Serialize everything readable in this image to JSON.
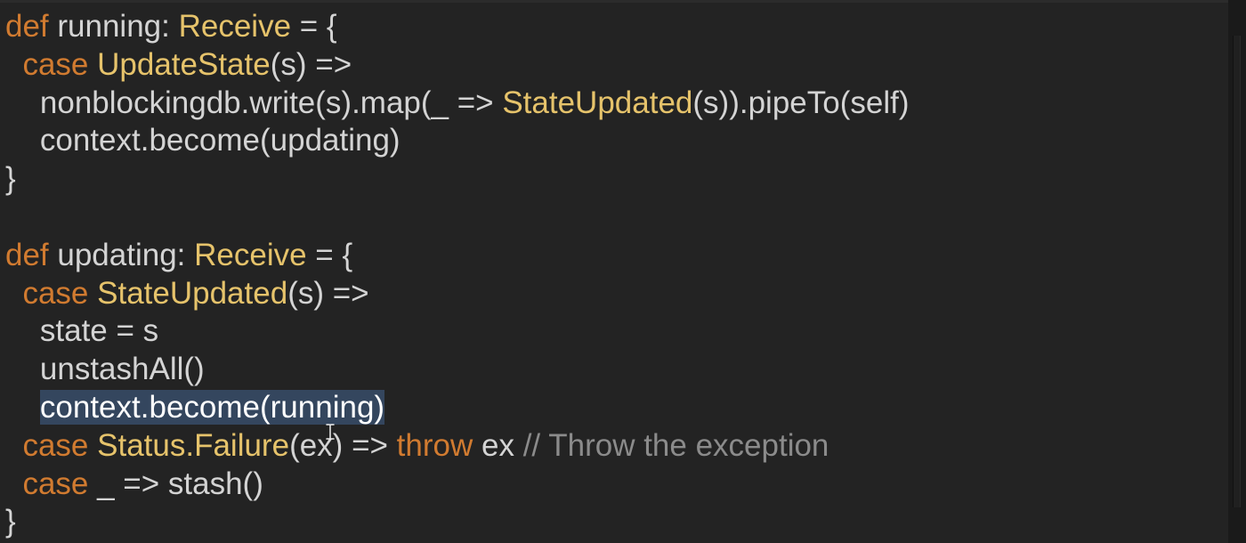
{
  "code_editor": {
    "lines": [
      [
        {
          "text": "def",
          "role": "kw"
        },
        {
          "text": " running: ",
          "role": "plain"
        },
        {
          "text": "Receive",
          "role": "type"
        },
        {
          "text": " = {",
          "role": "plain"
        }
      ],
      [
        {
          "text": "  ",
          "role": "plain"
        },
        {
          "text": "case",
          "role": "kw"
        },
        {
          "text": " ",
          "role": "plain"
        },
        {
          "text": "UpdateState",
          "role": "type"
        },
        {
          "text": "(s) =>",
          "role": "plain"
        }
      ],
      [
        {
          "text": "    nonblockingdb.write(s).map(_ => ",
          "role": "plain"
        },
        {
          "text": "StateUpdated",
          "role": "type"
        },
        {
          "text": "(s)).pipeTo(self)",
          "role": "plain"
        }
      ],
      [
        {
          "text": "    context.become(updating)",
          "role": "plain"
        }
      ],
      [
        {
          "text": "}",
          "role": "plain"
        }
      ],
      [
        {
          "text": "",
          "role": "plain"
        }
      ],
      [
        {
          "text": "def",
          "role": "kw"
        },
        {
          "text": " updating: ",
          "role": "plain"
        },
        {
          "text": "Receive",
          "role": "type"
        },
        {
          "text": " = {",
          "role": "plain"
        }
      ],
      [
        {
          "text": "  ",
          "role": "plain"
        },
        {
          "text": "case",
          "role": "kw"
        },
        {
          "text": " ",
          "role": "plain"
        },
        {
          "text": "StateUpdated",
          "role": "type"
        },
        {
          "text": "(s) =>",
          "role": "plain"
        }
      ],
      [
        {
          "text": "    state = s",
          "role": "plain"
        }
      ],
      [
        {
          "text": "    unstashAll()",
          "role": "plain"
        }
      ],
      [
        {
          "text": "    ",
          "role": "plain"
        },
        {
          "text": "context.become(running)",
          "role": "plain",
          "selected": true
        }
      ],
      [
        {
          "text": "  ",
          "role": "plain"
        },
        {
          "text": "case",
          "role": "kw"
        },
        {
          "text": " ",
          "role": "plain"
        },
        {
          "text": "Status.Failure",
          "role": "type"
        },
        {
          "text": "(ex) => ",
          "role": "plain"
        },
        {
          "text": "throw",
          "role": "kw"
        },
        {
          "text": " ex ",
          "role": "plain"
        },
        {
          "text": "// Throw the exception",
          "role": "comment"
        }
      ],
      [
        {
          "text": "  ",
          "role": "plain"
        },
        {
          "text": "case",
          "role": "kw"
        },
        {
          "text": " _ => stash()",
          "role": "plain"
        }
      ],
      [
        {
          "text": "}",
          "role": "plain"
        }
      ]
    ],
    "cursor": "text-cursor-icon"
  },
  "colors": {
    "background": "#232323",
    "keyword": "#d17b30",
    "type": "#e6c36b",
    "plain": "#d4d4d4",
    "comment": "#8b8b8b",
    "selection": "#34465e"
  }
}
